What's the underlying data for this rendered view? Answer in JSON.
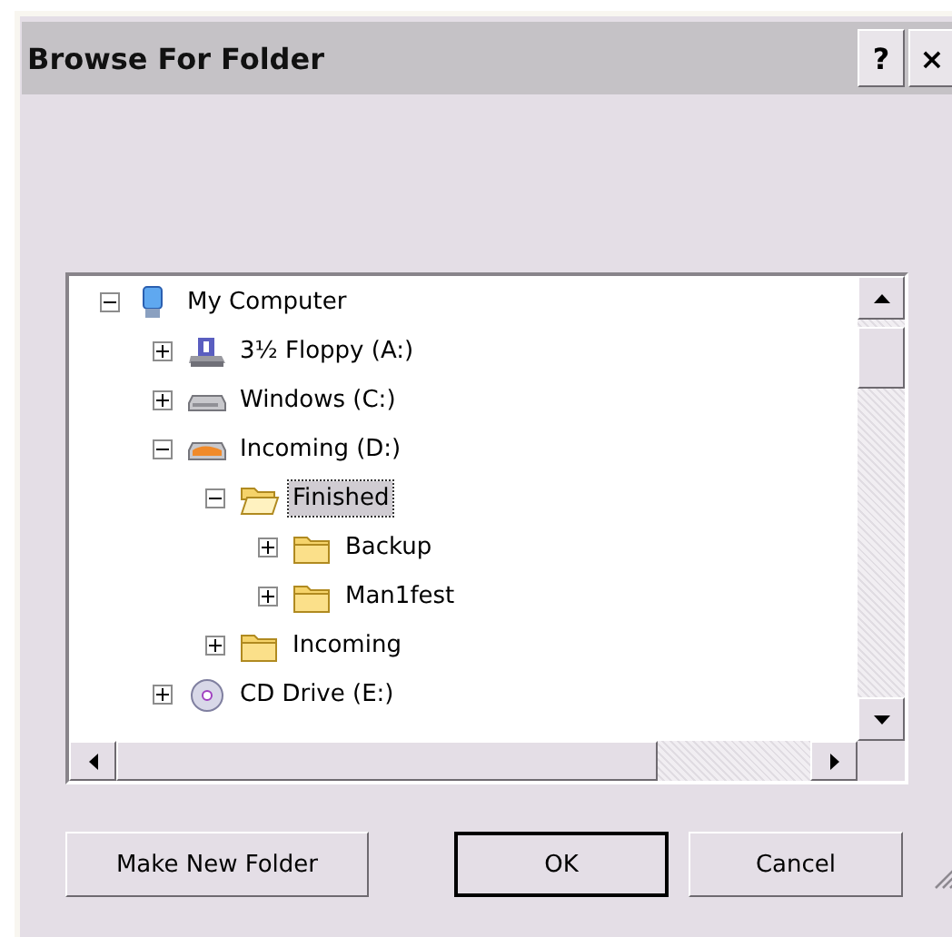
{
  "window": {
    "title": "Browse For Folder",
    "title_buttons": [
      "?",
      "×"
    ]
  },
  "tree": [
    {
      "label": "My Computer",
      "kind": "computer",
      "expanded": true,
      "selected": false,
      "children": [
        {
          "label": "3½ Floppy (A:)",
          "kind": "floppy",
          "expanded": false,
          "selected": false
        },
        {
          "label": "Windows (C:)",
          "kind": "drive",
          "expanded": false,
          "selected": false
        },
        {
          "label": "Incoming (D:)",
          "kind": "shared-drive",
          "expanded": true,
          "selected": false,
          "children": [
            {
              "label": "Finished",
              "kind": "folder",
              "expanded": true,
              "selected": true,
              "children": [
                {
                  "label": "Backup",
                  "kind": "folder",
                  "expanded": false,
                  "selected": false
                },
                {
                  "label": "Man1fest",
                  "kind": "folder",
                  "expanded": false,
                  "selected": false
                }
              ]
            },
            {
              "label": "Incoming",
              "kind": "folder",
              "expanded": false,
              "selected": false
            }
          ]
        },
        {
          "label": "CD Drive (E:)",
          "kind": "cd",
          "expanded": false,
          "selected": false
        }
      ]
    }
  ],
  "buttons": [
    {
      "label": "Make New Folder",
      "default": false
    },
    {
      "label": "OK",
      "default": true
    },
    {
      "label": "Cancel",
      "default": false
    }
  ]
}
